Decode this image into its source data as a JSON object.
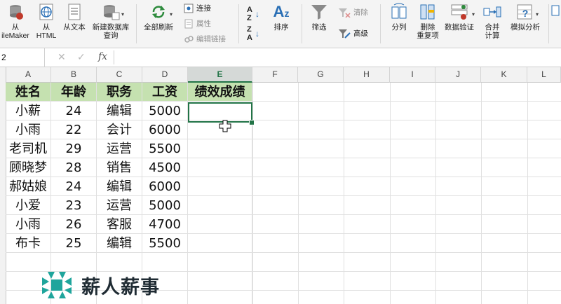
{
  "ribbon": {
    "get_data": [
      {
        "label": "从\nileMaker",
        "icon": "database-icon"
      },
      {
        "label": "从\nHTML",
        "icon": "globe-icon"
      },
      {
        "label": "从文本",
        "icon": "text-file-icon"
      },
      {
        "label": "新建数据库\n查询",
        "icon": "database-query-icon"
      }
    ],
    "refresh_all": "全部刷新",
    "connections": "连接",
    "properties": "属性",
    "edit_links": "编辑链接",
    "sort_asc": "A→Z",
    "sort_desc": "Z→A",
    "sort": "排序",
    "filter": "筛选",
    "clear": "清除",
    "advanced": "高级",
    "text_to_columns": "分列",
    "remove_duplicates": "删除\n重复项",
    "data_validation": "数据验证",
    "consolidate": "合并\n计算",
    "what_if": "模拟分析"
  },
  "formula_bar": {
    "name_box": "2",
    "fx": "fx",
    "cancel": "✕",
    "confirm": "✓"
  },
  "columns": [
    "A",
    "B",
    "C",
    "D",
    "E",
    "F",
    "G",
    "H",
    "I",
    "J",
    "K",
    "L"
  ],
  "selected_column": "E",
  "table": {
    "headers": [
      "姓名",
      "年龄",
      "职务",
      "工资",
      "绩效成绩"
    ],
    "rows": [
      [
        "小薪",
        "24",
        "编辑",
        "5000",
        ""
      ],
      [
        "小雨",
        "22",
        "会计",
        "6000",
        ""
      ],
      [
        "老司机",
        "29",
        "运营",
        "5500",
        ""
      ],
      [
        "顾晓梦",
        "28",
        "销售",
        "4500",
        ""
      ],
      [
        "郝姑娘",
        "24",
        "编辑",
        "6000",
        ""
      ],
      [
        "小爱",
        "23",
        "运营",
        "5000",
        ""
      ],
      [
        "小雨",
        "26",
        "客服",
        "4700",
        ""
      ],
      [
        "布卡",
        "25",
        "编辑",
        "5500",
        ""
      ]
    ]
  },
  "watermark": "薪人薪事",
  "colors": {
    "header_fill": "#c5e1b0",
    "excel_green": "#227447",
    "logo_teal": "#1fa59c"
  }
}
